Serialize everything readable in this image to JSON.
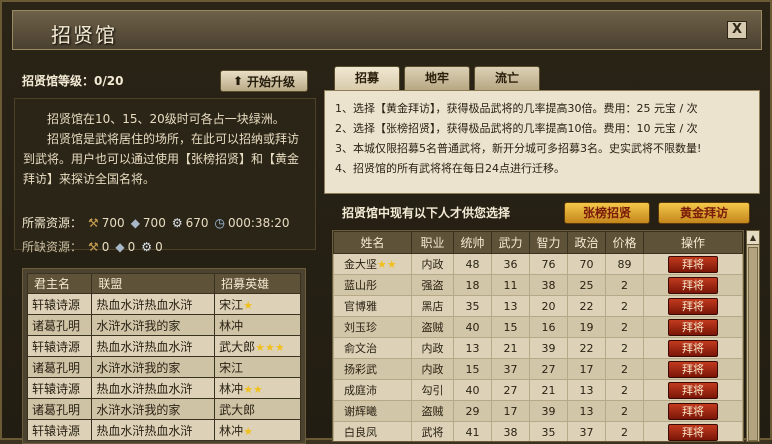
{
  "window": {
    "title": "招贤馆",
    "close_label": "X"
  },
  "left": {
    "level_label": "招贤馆等级：0/20",
    "upgrade_label": "开始升级",
    "description": [
      "招贤馆在10、15、20级时可各占一块绿洲。",
      "招贤馆是武将居住的场所，在此可以招纳或拜访到武将。用户也可以通过使用【张榜招贤】和【黄金拜访】来探访全国名将。"
    ],
    "required": {
      "label": "所需资源：",
      "wood": "700",
      "stone": "700",
      "iron": "670",
      "time": "000:38:20"
    },
    "missing": {
      "label": "所缺资源：",
      "wood": "0",
      "stone": "0",
      "iron": "0"
    },
    "table": {
      "headers": [
        "君主名",
        "联盟",
        "招募英雄"
      ],
      "rows": [
        {
          "lord": "轩辕诗源",
          "alliance": "热血水浒热血水浒",
          "hero": "宋江",
          "stars": "★"
        },
        {
          "lord": "诸葛孔明",
          "alliance": "水浒水浒我的家",
          "hero": "林冲",
          "stars": ""
        },
        {
          "lord": "轩辕诗源",
          "alliance": "热血水浒热血水浒",
          "hero": "武大郎",
          "stars": "★★★"
        },
        {
          "lord": "诸葛孔明",
          "alliance": "水浒水浒我的家",
          "hero": "宋江",
          "stars": ""
        },
        {
          "lord": "轩辕诗源",
          "alliance": "热血水浒热血水浒",
          "hero": "林冲",
          "stars": "★★"
        },
        {
          "lord": "诸葛孔明",
          "alliance": "水浒水浒我的家",
          "hero": "武大郎",
          "stars": ""
        },
        {
          "lord": "轩辕诗源",
          "alliance": "热血水浒热血水浒",
          "hero": "林冲",
          "stars": "★"
        }
      ]
    }
  },
  "right": {
    "tabs": [
      "招募",
      "地牢",
      "流亡"
    ],
    "rules": [
      "1、选择【黄金拜访】，获得极品武将的几率提高30倍。费用：25 元宝 / 次",
      "2、选择【张榜招贤】，获得极品武将的几率提高10倍。费用：10 元宝 / 次",
      "3、本城仅限招募5名普通武将，新开分城可多招募3名。史实武将不限数量!",
      "4、招贤馆的所有武将将在每日24点进行迁移。"
    ],
    "list_header": "招贤馆中现有以下人才供您选择",
    "btn_zhangbang": "张榜招贤",
    "btn_huangjin": "黄金拜访",
    "columns": [
      "姓名",
      "职业",
      "统帅",
      "武力",
      "智力",
      "政治",
      "价格",
      "操作"
    ],
    "hire_label": "拜将",
    "heroes": [
      {
        "name": "金大坚",
        "stars": "★★",
        "job": "内政",
        "lead": "48",
        "force": "36",
        "intel": "76",
        "pol": "70",
        "price": "89"
      },
      {
        "name": "蓝山彤",
        "stars": "",
        "job": "强盗",
        "lead": "18",
        "force": "11",
        "intel": "38",
        "pol": "25",
        "price": "2"
      },
      {
        "name": "官博雅",
        "stars": "",
        "job": "黑店",
        "lead": "35",
        "force": "13",
        "intel": "20",
        "pol": "22",
        "price": "2"
      },
      {
        "name": "刘玉珍",
        "stars": "",
        "job": "盗贼",
        "lead": "40",
        "force": "15",
        "intel": "16",
        "pol": "19",
        "price": "2"
      },
      {
        "name": "俞文治",
        "stars": "",
        "job": "内政",
        "lead": "13",
        "force": "21",
        "intel": "39",
        "pol": "22",
        "price": "2"
      },
      {
        "name": "扬彩武",
        "stars": "",
        "job": "内政",
        "lead": "15",
        "force": "37",
        "intel": "27",
        "pol": "17",
        "price": "2"
      },
      {
        "name": "成庭沛",
        "stars": "",
        "job": "勾引",
        "lead": "40",
        "force": "27",
        "intel": "21",
        "pol": "13",
        "price": "2"
      },
      {
        "name": "谢辉曦",
        "stars": "",
        "job": "盗贼",
        "lead": "29",
        "force": "17",
        "intel": "39",
        "pol": "13",
        "price": "2"
      },
      {
        "name": "白良凤",
        "stars": "",
        "job": "武将",
        "lead": "41",
        "force": "38",
        "intel": "35",
        "pol": "37",
        "price": "2"
      }
    ]
  }
}
